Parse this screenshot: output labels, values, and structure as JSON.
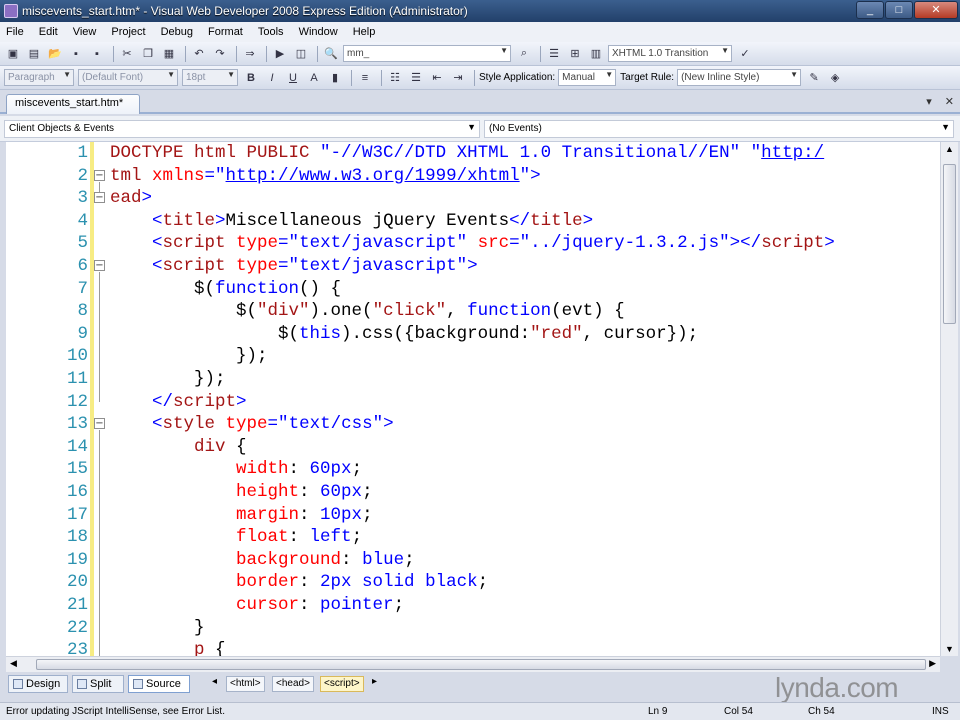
{
  "window": {
    "title": "miscevents_start.htm* - Visual Web Developer 2008 Express Edition (Administrator)"
  },
  "menu": [
    "File",
    "Edit",
    "View",
    "Project",
    "Debug",
    "Format",
    "Tools",
    "Window",
    "Help"
  ],
  "toolbar1": {
    "find_value": "mm_",
    "doctype": "XHTML 1.0 Transition"
  },
  "toolbar2": {
    "block_format": "Paragraph",
    "font": "(Default Font)",
    "size": "18pt",
    "style_application_label": "Style Application:",
    "style_application_value": "Manual",
    "target_rule_label": "Target Rule:",
    "target_rule_value": "(New Inline Style)"
  },
  "document_tab": {
    "label": "miscevents_start.htm*"
  },
  "navbar": {
    "left": "Client Objects & Events",
    "right": "(No Events)"
  },
  "editor": {
    "lines": [
      {
        "n": "1",
        "fold": "",
        "tokens": [
          [
            "t-tag",
            "DOCTYPE html PUBLIC "
          ],
          [
            "t-val",
            "\"-//W3C//DTD XHTML 1.0 Transitional//EN\""
          ],
          [
            "t-plain",
            " "
          ],
          [
            "t-val",
            "\""
          ],
          [
            "t-link",
            "http:/"
          ]
        ]
      },
      {
        "n": "2",
        "fold": "−",
        "tokens": [
          [
            "t-tag",
            "tml "
          ],
          [
            "t-attr",
            "xmlns"
          ],
          [
            "t-punct",
            "=\""
          ],
          [
            "t-link",
            "http://www.w3.org/1999/xhtml"
          ],
          [
            "t-punct",
            "\">"
          ]
        ]
      },
      {
        "n": "3",
        "fold": "−",
        "tokens": [
          [
            "t-tag",
            "ead"
          ],
          [
            "t-punct",
            ">"
          ]
        ]
      },
      {
        "n": "4",
        "fold": "",
        "tokens": [
          [
            "t-punct",
            "    <"
          ],
          [
            "t-tag",
            "title"
          ],
          [
            "t-punct",
            ">"
          ],
          [
            "t-plain",
            "Miscellaneous jQuery Events"
          ],
          [
            "t-punct",
            "</"
          ],
          [
            "t-tag",
            "title"
          ],
          [
            "t-punct",
            ">"
          ]
        ]
      },
      {
        "n": "5",
        "fold": "",
        "tokens": [
          [
            "t-punct",
            "    <"
          ],
          [
            "t-tag",
            "script "
          ],
          [
            "t-attr",
            "type"
          ],
          [
            "t-punct",
            "=\""
          ],
          [
            "t-val",
            "text/javascript"
          ],
          [
            "t-punct",
            "\" "
          ],
          [
            "t-attr",
            "src"
          ],
          [
            "t-punct",
            "=\""
          ],
          [
            "t-val",
            "../jquery-1.3.2.js"
          ],
          [
            "t-punct",
            "\"></"
          ],
          [
            "t-tag",
            "script"
          ],
          [
            "t-punct",
            ">"
          ]
        ]
      },
      {
        "n": "6",
        "fold": "−",
        "tokens": [
          [
            "t-punct",
            "    <"
          ],
          [
            "t-tag",
            "script "
          ],
          [
            "t-attr",
            "type"
          ],
          [
            "t-punct",
            "=\""
          ],
          [
            "t-val",
            "text/javascript"
          ],
          [
            "t-punct",
            "\">"
          ]
        ]
      },
      {
        "n": "7",
        "fold": "",
        "tokens": [
          [
            "t-plain",
            "        $("
          ],
          [
            "t-kw",
            "function"
          ],
          [
            "t-plain",
            "() {"
          ]
        ]
      },
      {
        "n": "8",
        "fold": "",
        "tokens": [
          [
            "t-plain",
            "            $("
          ],
          [
            "t-str",
            "\"div\""
          ],
          [
            "t-plain",
            ").one("
          ],
          [
            "t-str",
            "\"click\""
          ],
          [
            "t-plain",
            ", "
          ],
          [
            "t-kw",
            "function"
          ],
          [
            "t-plain",
            "(evt) {"
          ]
        ]
      },
      {
        "n": "9",
        "fold": "",
        "tokens": [
          [
            "t-plain",
            "                $("
          ],
          [
            "t-kw",
            "this"
          ],
          [
            "t-plain",
            ").css({background:"
          ],
          [
            "t-str",
            "\"red\""
          ],
          [
            "t-plain",
            ", cursor});"
          ]
        ]
      },
      {
        "n": "10",
        "fold": "",
        "tokens": [
          [
            "t-plain",
            "            });"
          ]
        ]
      },
      {
        "n": "11",
        "fold": "",
        "tokens": [
          [
            "t-plain",
            "        });"
          ]
        ]
      },
      {
        "n": "12",
        "fold": "",
        "tokens": [
          [
            "t-punct",
            "    </"
          ],
          [
            "t-tag",
            "script"
          ],
          [
            "t-punct",
            ">"
          ]
        ]
      },
      {
        "n": "13",
        "fold": "−",
        "tokens": [
          [
            "t-punct",
            "    <"
          ],
          [
            "t-tag",
            "style "
          ],
          [
            "t-attr",
            "type"
          ],
          [
            "t-punct",
            "=\""
          ],
          [
            "t-val",
            "text/css"
          ],
          [
            "t-punct",
            "\">"
          ]
        ]
      },
      {
        "n": "14",
        "fold": "",
        "tokens": [
          [
            "t-tag",
            "        div "
          ],
          [
            "t-plain",
            "{"
          ]
        ]
      },
      {
        "n": "15",
        "fold": "",
        "tokens": [
          [
            "t-attr",
            "            width"
          ],
          [
            "t-plain",
            ": "
          ],
          [
            "t-val",
            "60px"
          ],
          [
            "t-plain",
            ";"
          ]
        ]
      },
      {
        "n": "16",
        "fold": "",
        "tokens": [
          [
            "t-attr",
            "            height"
          ],
          [
            "t-plain",
            ": "
          ],
          [
            "t-val",
            "60px"
          ],
          [
            "t-plain",
            ";"
          ]
        ]
      },
      {
        "n": "17",
        "fold": "",
        "tokens": [
          [
            "t-attr",
            "            margin"
          ],
          [
            "t-plain",
            ": "
          ],
          [
            "t-val",
            "10px"
          ],
          [
            "t-plain",
            ";"
          ]
        ]
      },
      {
        "n": "18",
        "fold": "",
        "tokens": [
          [
            "t-attr",
            "            float"
          ],
          [
            "t-plain",
            ": "
          ],
          [
            "t-val",
            "left"
          ],
          [
            "t-plain",
            ";"
          ]
        ]
      },
      {
        "n": "19",
        "fold": "",
        "tokens": [
          [
            "t-attr",
            "            background"
          ],
          [
            "t-plain",
            ": "
          ],
          [
            "t-val",
            "blue"
          ],
          [
            "t-plain",
            ";"
          ]
        ]
      },
      {
        "n": "20",
        "fold": "",
        "tokens": [
          [
            "t-attr",
            "            border"
          ],
          [
            "t-plain",
            ": "
          ],
          [
            "t-val",
            "2px solid black"
          ],
          [
            "t-plain",
            ";"
          ]
        ]
      },
      {
        "n": "21",
        "fold": "",
        "tokens": [
          [
            "t-attr",
            "            cursor"
          ],
          [
            "t-plain",
            ": "
          ],
          [
            "t-val",
            "pointer"
          ],
          [
            "t-plain",
            ";"
          ]
        ]
      },
      {
        "n": "22",
        "fold": "",
        "tokens": [
          [
            "t-plain",
            "        }"
          ]
        ]
      },
      {
        "n": "23",
        "fold": "",
        "tokens": [
          [
            "t-tag",
            "        p "
          ],
          [
            "t-plain",
            "{"
          ]
        ]
      }
    ]
  },
  "view_tabs": [
    "Design",
    "Split",
    "Source"
  ],
  "breadcrumbs": [
    "<html>",
    "<head>",
    "<script>"
  ],
  "watermark": "lynda.com",
  "status": {
    "message": "Error updating JScript IntelliSense, see Error List.",
    "line": "Ln 9",
    "col": "Col 54",
    "ch": "Ch 54",
    "mode": "INS"
  }
}
